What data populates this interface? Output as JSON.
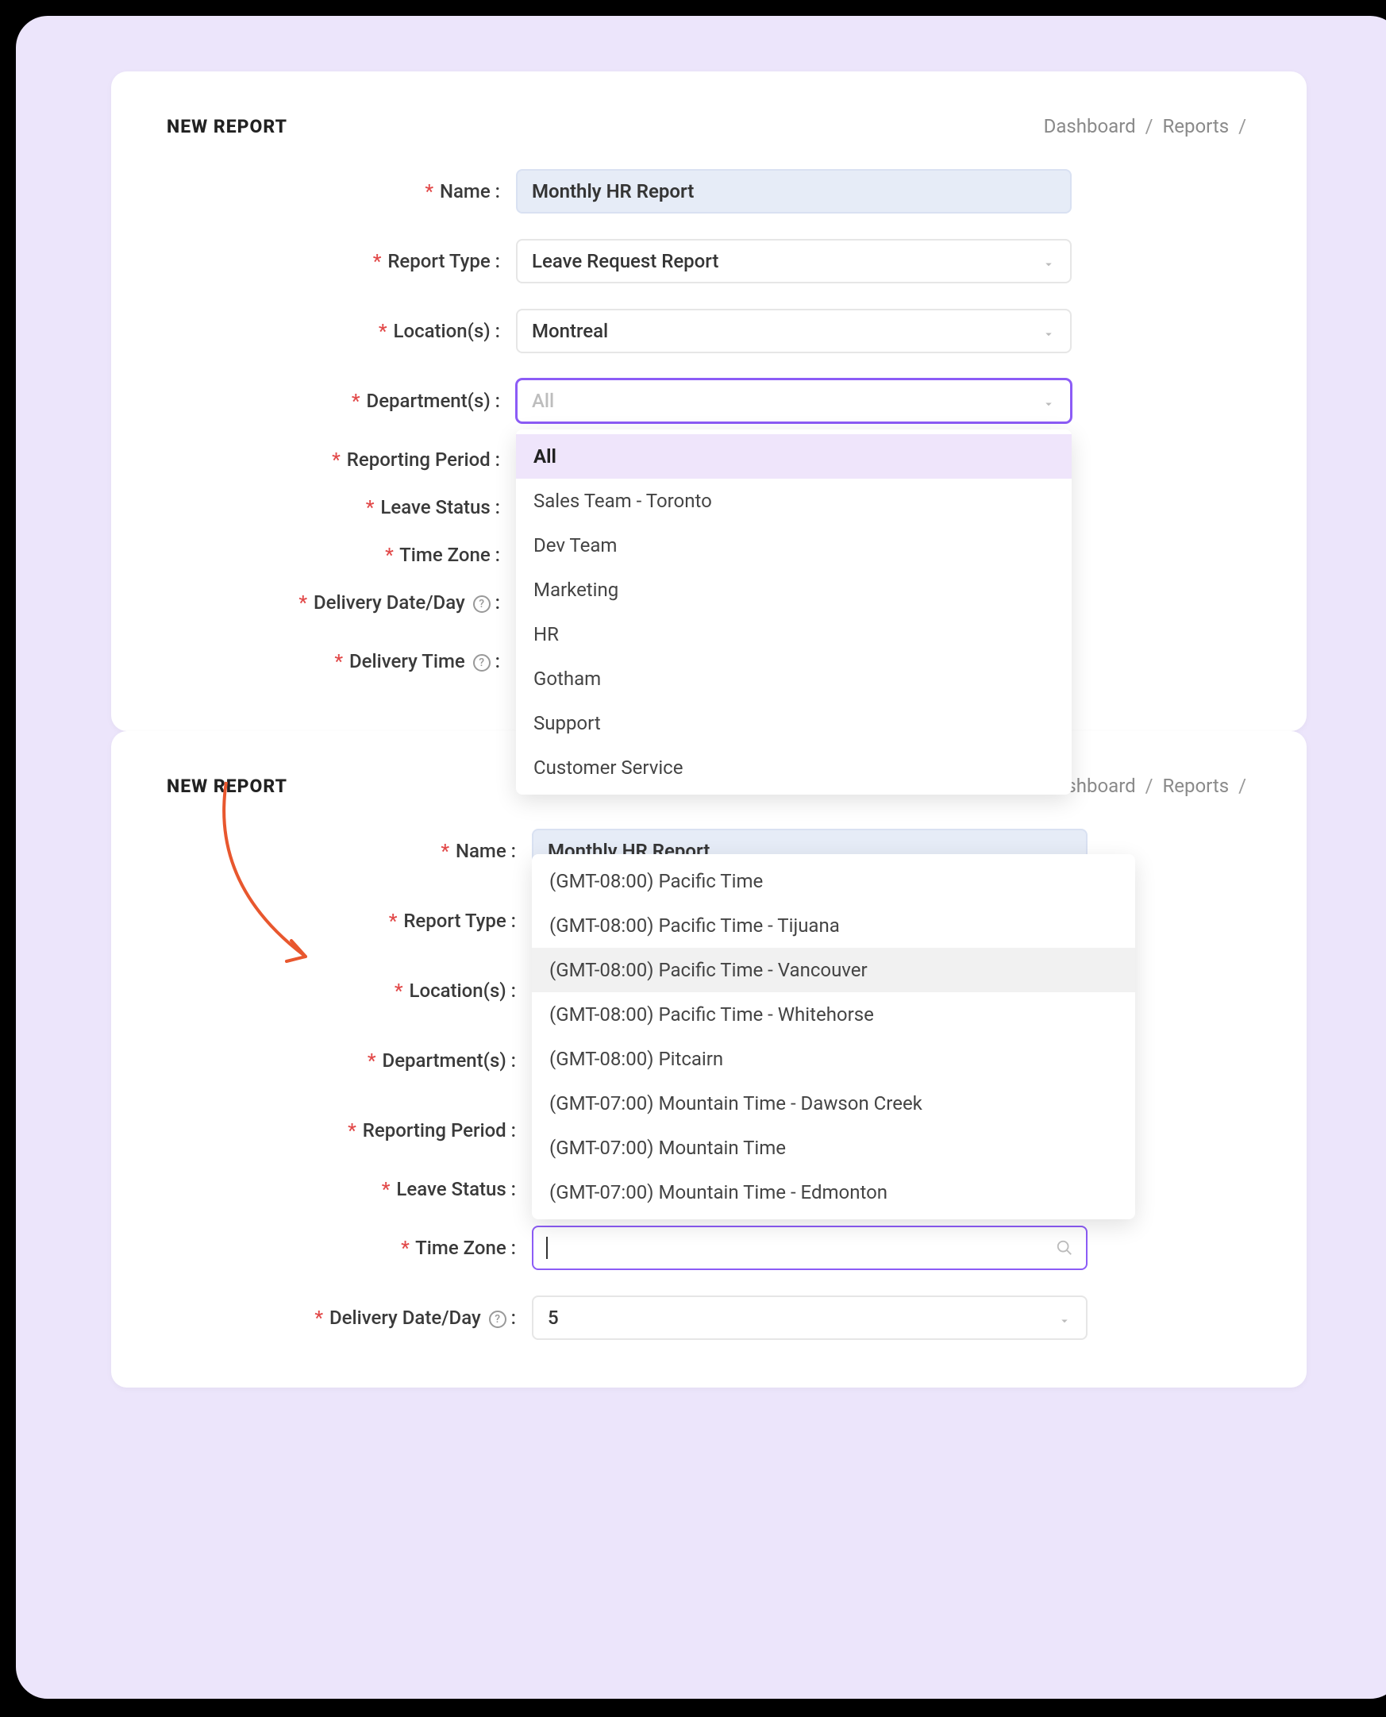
{
  "card1": {
    "title": "NEW REPORT",
    "breadcrumb": [
      "Dashboard",
      "Reports"
    ],
    "fields": {
      "name": {
        "label": "Name :",
        "value": "Monthly HR Report"
      },
      "report_type": {
        "label": "Report Type :",
        "value": "Leave Request Report"
      },
      "locations": {
        "label": "Location(s) :",
        "value": "Montreal"
      },
      "departments": {
        "label": "Department(s) :",
        "placeholder": "All",
        "options": [
          "All",
          "Sales Team - Toronto",
          "Dev Team",
          "Marketing",
          "HR",
          "Gotham",
          "Support",
          "Customer Service"
        ],
        "selected": "All"
      },
      "reporting_period": {
        "label": "Reporting Period :"
      },
      "leave_status": {
        "label": "Leave Status :"
      },
      "time_zone": {
        "label": "Time Zone :"
      },
      "delivery_date": {
        "label": "Delivery Date/Day"
      },
      "delivery_time": {
        "label": "Delivery Time"
      }
    }
  },
  "card2": {
    "title": "NEW REPORT",
    "breadcrumb": [
      "Dashboard",
      "Reports"
    ],
    "fields": {
      "name": {
        "label": "Name :",
        "value": "Monthly HR Report"
      },
      "report_type": {
        "label": "Report Type :"
      },
      "locations": {
        "label": "Location(s) :"
      },
      "departments": {
        "label": "Department(s) :"
      },
      "reporting_period": {
        "label": "Reporting Period :"
      },
      "leave_status": {
        "label": "Leave Status :"
      },
      "time_zone": {
        "label": "Time Zone :",
        "options": [
          "(GMT-08:00) Pacific Time",
          "(GMT-08:00) Pacific Time - Tijuana",
          "(GMT-08:00) Pacific Time - Vancouver",
          "(GMT-08:00) Pacific Time - Whitehorse",
          "(GMT-08:00) Pitcairn",
          "(GMT-07:00) Mountain Time - Dawson Creek",
          "(GMT-07:00) Mountain Time",
          "(GMT-07:00) Mountain Time - Edmonton"
        ],
        "hover_index": 2
      },
      "delivery_date": {
        "label": "Delivery Date/Day",
        "value": "5"
      }
    }
  }
}
